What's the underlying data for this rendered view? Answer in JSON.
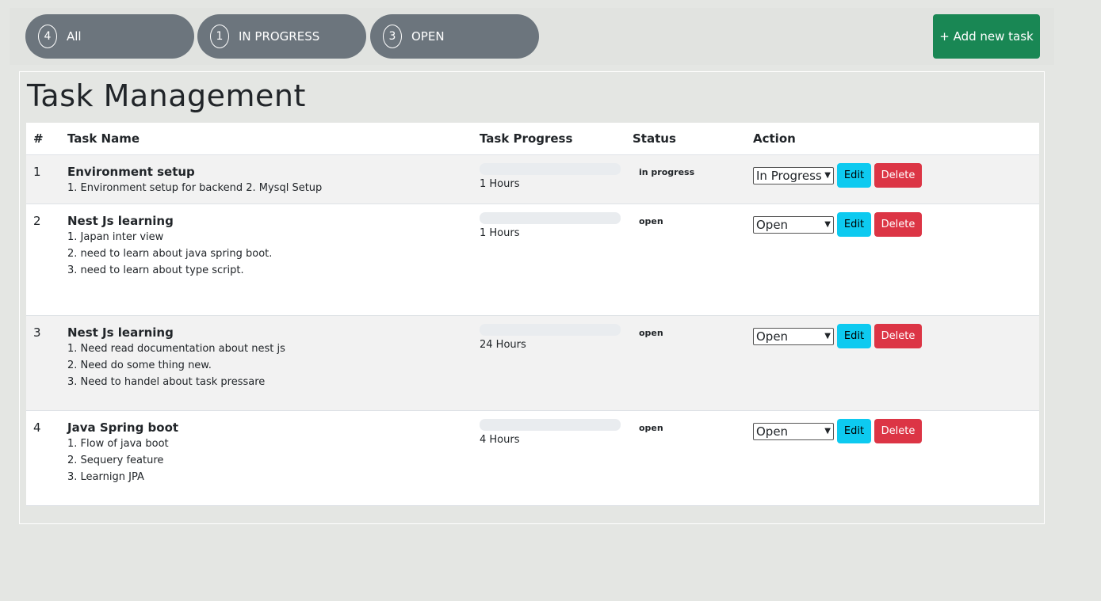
{
  "filters": [
    {
      "count": "4",
      "label": "All"
    },
    {
      "count": "1",
      "label": "IN PROGRESS"
    },
    {
      "count": "3",
      "label": "OPEN"
    }
  ],
  "add_button_label": "+ Add new task",
  "title": "Task Management",
  "table": {
    "headers": [
      "#",
      "Task Name",
      "Task Progress",
      "Status",
      "Action"
    ],
    "rows": [
      {
        "num": "1",
        "name": "Environment setup",
        "lines": [
          "1. Environment setup for backend 2. Mysql Setup"
        ],
        "progress": 0,
        "hours": "1 Hours",
        "status": "in progress",
        "select": "In Progress",
        "edit": "Edit",
        "delete": "Delete"
      },
      {
        "num": "2",
        "name": "Nest Js learning",
        "lines": [
          "1. Japan inter view",
          "2. need to learn about java spring boot.",
          "3. need to learn about type script."
        ],
        "progress": 0,
        "hours": "1 Hours",
        "status": "open",
        "select": "Open",
        "edit": "Edit",
        "delete": "Delete"
      },
      {
        "num": "3",
        "name": "Nest Js learning",
        "lines": [
          "1. Need read documentation about nest js",
          "2. Need do some thing new.",
          "3. Need to handel about task pressare"
        ],
        "progress": 0,
        "hours": "24 Hours",
        "status": "open",
        "select": "Open",
        "edit": "Edit",
        "delete": "Delete"
      },
      {
        "num": "4",
        "name": "Java Spring boot",
        "lines": [
          "1. Flow of java boot",
          "2. Sequery feature",
          "3. Learnign JPA"
        ],
        "progress": 0,
        "hours": "4 Hours",
        "status": "open",
        "select": "Open",
        "edit": "Edit",
        "delete": "Delete"
      }
    ]
  },
  "colors": {
    "filter_bg": "#6c757d",
    "add_button_bg": "#198754",
    "edit_bg": "#0dcaf0",
    "delete_bg": "#dc3545",
    "page_bg": "#e4e6e3"
  }
}
